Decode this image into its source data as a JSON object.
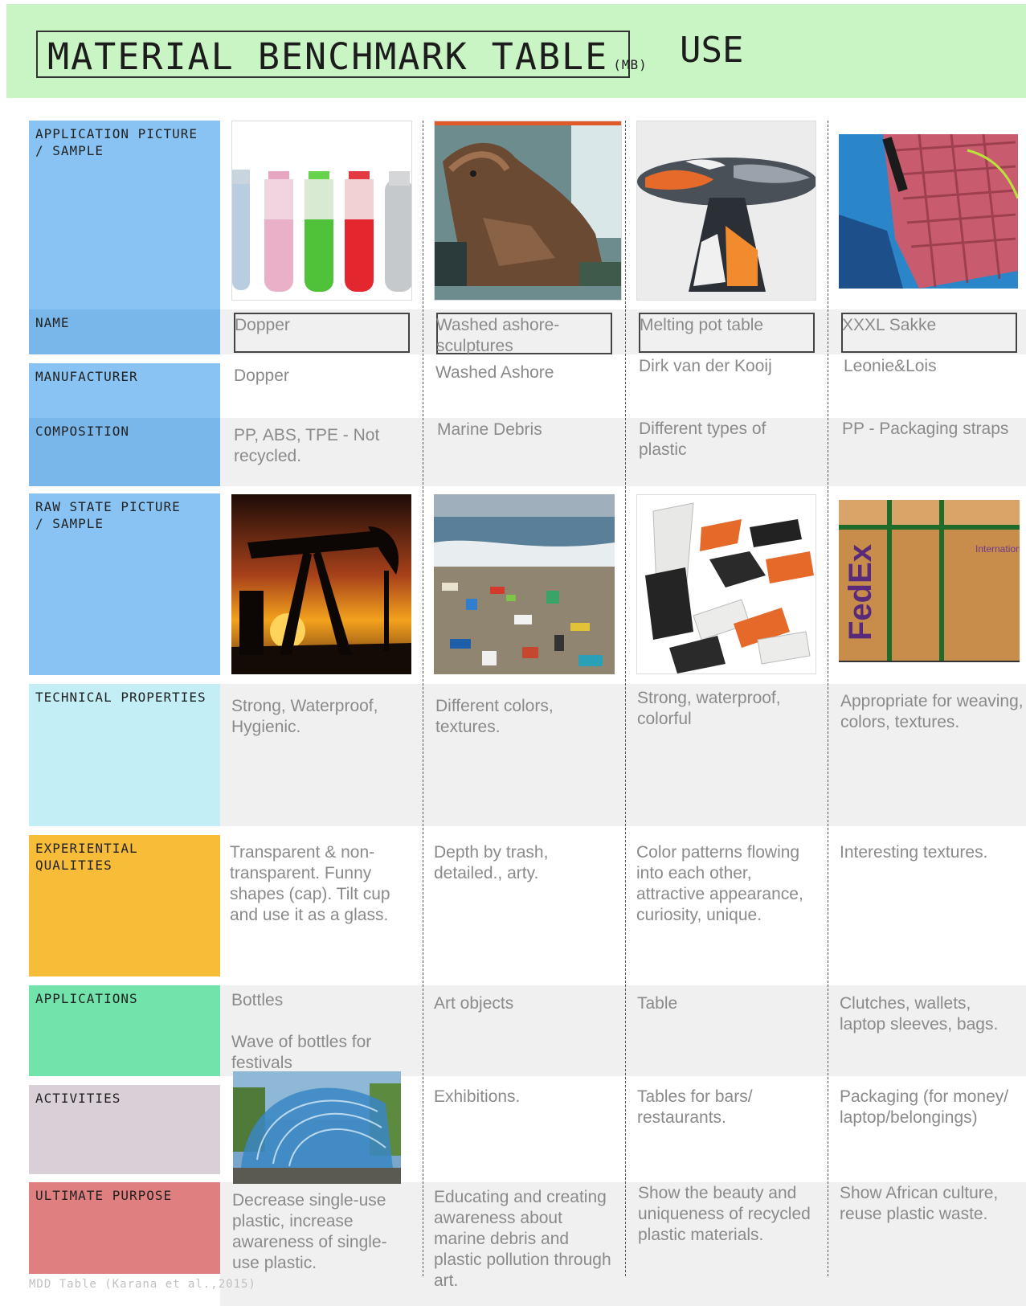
{
  "header": {
    "title": "MATERIAL BENCHMARK TABLE",
    "title_suffix": "(MB)",
    "section": "USE"
  },
  "labels": {
    "application_picture": "APPLICATION PICTURE\n/ SAMPLE",
    "name": "NAME",
    "manufacturer": "MANUFACTURER",
    "composition": "COMPOSITION",
    "raw_state_picture": "RAW STATE PICTURE\n/ SAMPLE",
    "technical_properties": "TECHNICAL PROPERTIES",
    "experiential_qualities": "EXPERIENTIAL\nQUALITIES",
    "applications": "APPLICATIONS",
    "activities": "ACTIVITIES",
    "ultimate_purpose": "ULTIMATE PURPOSE"
  },
  "label_colors": {
    "picture": "#88c3f3",
    "mid": "#79b6ea",
    "technical": "#c3eef6",
    "experiential": "#f8bd38",
    "applications": "#73e3ac",
    "activities": "#d9cfd7",
    "purpose": "#e07f80"
  },
  "columns": [
    {
      "name": "Dopper",
      "manufacturer": "Dopper",
      "composition": "PP, ABS, TPE - Not recycled.",
      "technical": "Strong, Waterproof, Hygienic.",
      "experiential": "Transparent & non-transparent. Funny shapes (cap). Tilt cup and use it as a glass.",
      "applications": "Bottles",
      "applications_extra": "Wave of bottles for festivals",
      "activities": "",
      "purpose": "Decrease single-use plastic, increase awareness of single-use plastic."
    },
    {
      "name": "Washed ashore-\nsculptures",
      "manufacturer": "Washed Ashore",
      "composition": "Marine Debris",
      "technical": "Different colors, textures.",
      "experiential": "Depth by trash, detailed., arty.",
      "applications": "Art objects",
      "applications_extra": "",
      "activities": "Exhibitions.",
      "purpose": "Educating and creating awareness about marine debris and plastic pollution through art."
    },
    {
      "name": "Melting pot table",
      "manufacturer": "Dirk van der Kooij",
      "composition": "Different types of plastic",
      "technical": "Strong, waterproof, colorful",
      "experiential": "Color patterns flowing into each other, attractive appearance, curiosity, unique.",
      "applications": "Table",
      "applications_extra": "",
      "activities": "Tables for bars/ restaurants.",
      "purpose": "Show the beauty and uniqueness of recycled plastic materials."
    },
    {
      "name": "XXXL Sakke",
      "manufacturer": "Leonie&Lois",
      "composition": "PP - Packaging straps",
      "technical": "Appropriate for weaving, colors, textures.",
      "experiential": "Interesting textures.",
      "applications": "Clutches, wallets, laptop sleeves, bags.",
      "applications_extra": "",
      "activities": "Packaging (for money/ laptop/belongings)",
      "purpose": "Show African culture, reuse plastic waste."
    }
  ],
  "footer": "MDD Table (Karana et al.,2015)"
}
